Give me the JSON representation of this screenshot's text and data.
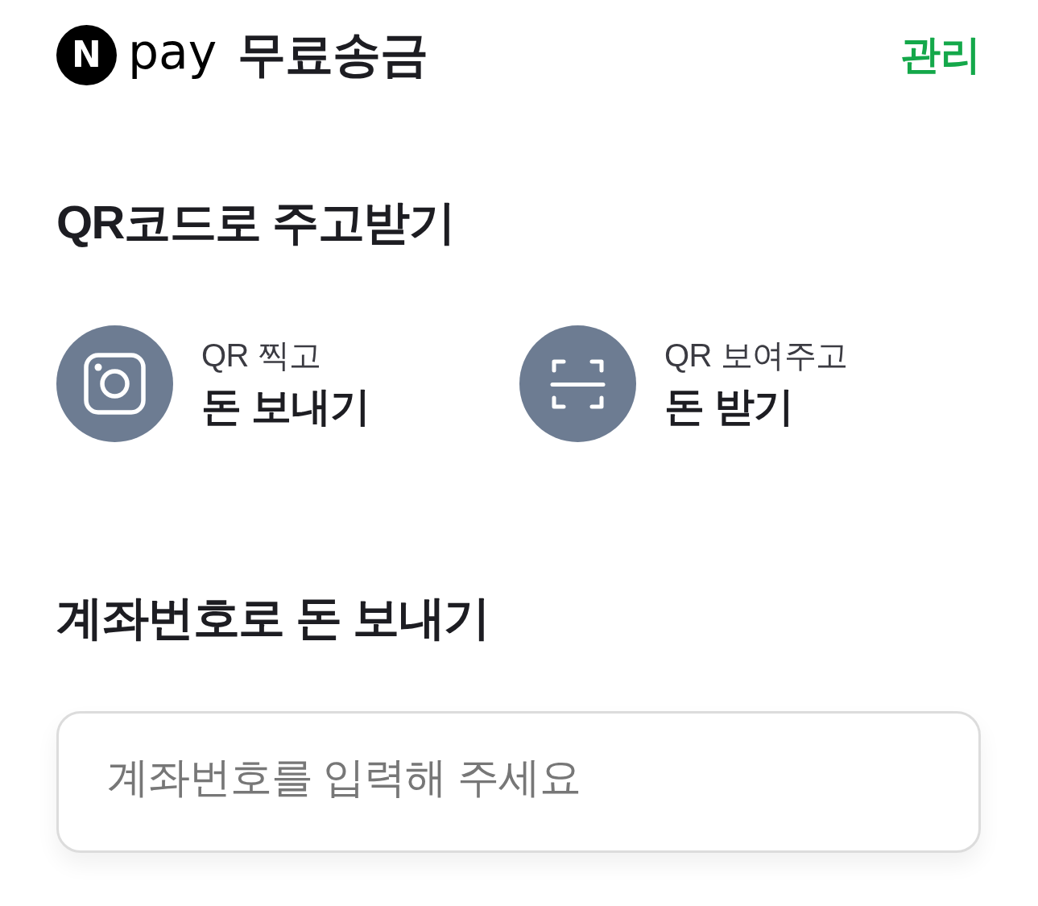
{
  "header": {
    "logo": {
      "badge": "N",
      "wordmark": "pay"
    },
    "title": "무료송금",
    "manage_link": "관리"
  },
  "qr_section": {
    "heading": "QR코드로 주고받기",
    "actions": [
      {
        "kind": "camera",
        "subtitle": "QR 찍고",
        "title": "돈 보내기"
      },
      {
        "kind": "scan",
        "subtitle": "QR 보여주고",
        "title": "돈 받기"
      }
    ]
  },
  "account_section": {
    "heading": "계좌번호로 돈 보내기",
    "input": {
      "placeholder": "계좌번호를 입력해 주세요"
    }
  }
}
